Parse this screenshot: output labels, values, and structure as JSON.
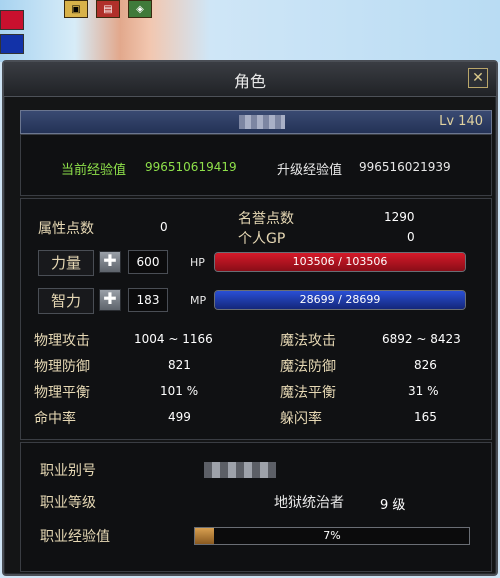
{
  "window": {
    "title": "角色"
  },
  "header": {
    "level": "Lv 140"
  },
  "experience": {
    "current_label": "当前经验值",
    "current_value": "996510619419",
    "upgrade_label": "升级经验值",
    "upgrade_value": "996516021939"
  },
  "points": {
    "attr_label": "属性点数",
    "attr_value": "0",
    "honor_label": "名誉点数",
    "honor_value": "1290",
    "gp_label": "个人GP",
    "gp_value": "0"
  },
  "attributes": {
    "strength_label": "力量",
    "strength_value": "600",
    "intelligence_label": "智力",
    "intelligence_value": "183",
    "plus_symbol": "✚",
    "hp_tag": "HP",
    "hp_text": "103506 / 103506",
    "hp_fraction": 1.0,
    "mp_tag": "MP",
    "mp_text": "28699 / 28699",
    "mp_fraction": 1.0
  },
  "stats": {
    "phys_attack_label": "物理攻击",
    "phys_attack_value": "1004 ~ 1166",
    "mag_attack_label": "魔法攻击",
    "mag_attack_value": "6892 ~ 8423",
    "phys_def_label": "物理防御",
    "phys_def_value": "821",
    "mag_def_label": "魔法防御",
    "mag_def_value": "826",
    "phys_balance_label": "物理平衡",
    "phys_balance_value": "101 %",
    "mag_balance_label": "魔法平衡",
    "mag_balance_value": "31 %",
    "hit_label": "命中率",
    "hit_value": "499",
    "evade_label": "躲闪率",
    "evade_value": "165"
  },
  "job": {
    "alias_label": "职业别号",
    "level_label": "职业等级",
    "level_name": "地狱统治者",
    "level_value": "9 级",
    "exp_label": "职业经验值",
    "exp_text": "7%",
    "exp_fraction": 0.07
  },
  "colors": {
    "hp_bar": "#d61a2a",
    "mp_bar": "#2a4fd6",
    "accent_gold": "#e6c04a",
    "exp_green": "#8ee04a"
  },
  "icons": {
    "close": "close-icon",
    "top_icons": [
      "bag-icon",
      "shop-icon",
      "map-icon"
    ]
  }
}
